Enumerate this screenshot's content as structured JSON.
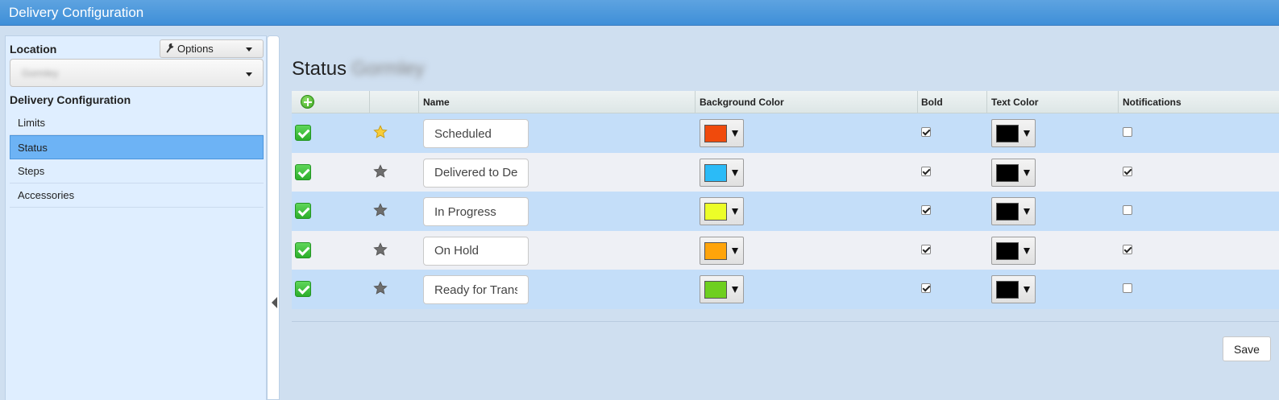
{
  "window": {
    "title": "Delivery Configuration"
  },
  "sidebar": {
    "location_label": "Location",
    "options_label": "Options",
    "location_value": "Gormley",
    "section_title": "Delivery Configuration",
    "items": [
      {
        "label": "Limits",
        "active": false
      },
      {
        "label": "Status",
        "active": true
      },
      {
        "label": "Steps",
        "active": false
      },
      {
        "label": "Accessories",
        "active": false
      }
    ]
  },
  "main": {
    "title": "Status",
    "title_suffix": "Gormley",
    "columns": {
      "name": "Name",
      "background_color": "Background Color",
      "bold": "Bold",
      "text_color": "Text Color",
      "notifications": "Notifications"
    },
    "rows": [
      {
        "name": "Scheduled",
        "default": true,
        "bg_color": "#f04a0c",
        "bold": true,
        "text_color": "#000000",
        "notifications": false
      },
      {
        "name": "Delivered to Destination",
        "default": false,
        "bg_color": "#2bbbf7",
        "bold": true,
        "text_color": "#000000",
        "notifications": true
      },
      {
        "name": "In Progress",
        "default": false,
        "bg_color": "#ecfd28",
        "bold": true,
        "text_color": "#000000",
        "notifications": false
      },
      {
        "name": "On Hold",
        "default": false,
        "bg_color": "#ffa40a",
        "bold": true,
        "text_color": "#000000",
        "notifications": true
      },
      {
        "name": "Ready for Transport",
        "default": false,
        "bg_color": "#6ecf1f",
        "bold": true,
        "text_color": "#000000",
        "notifications": false
      }
    ],
    "save_label": "Save"
  }
}
